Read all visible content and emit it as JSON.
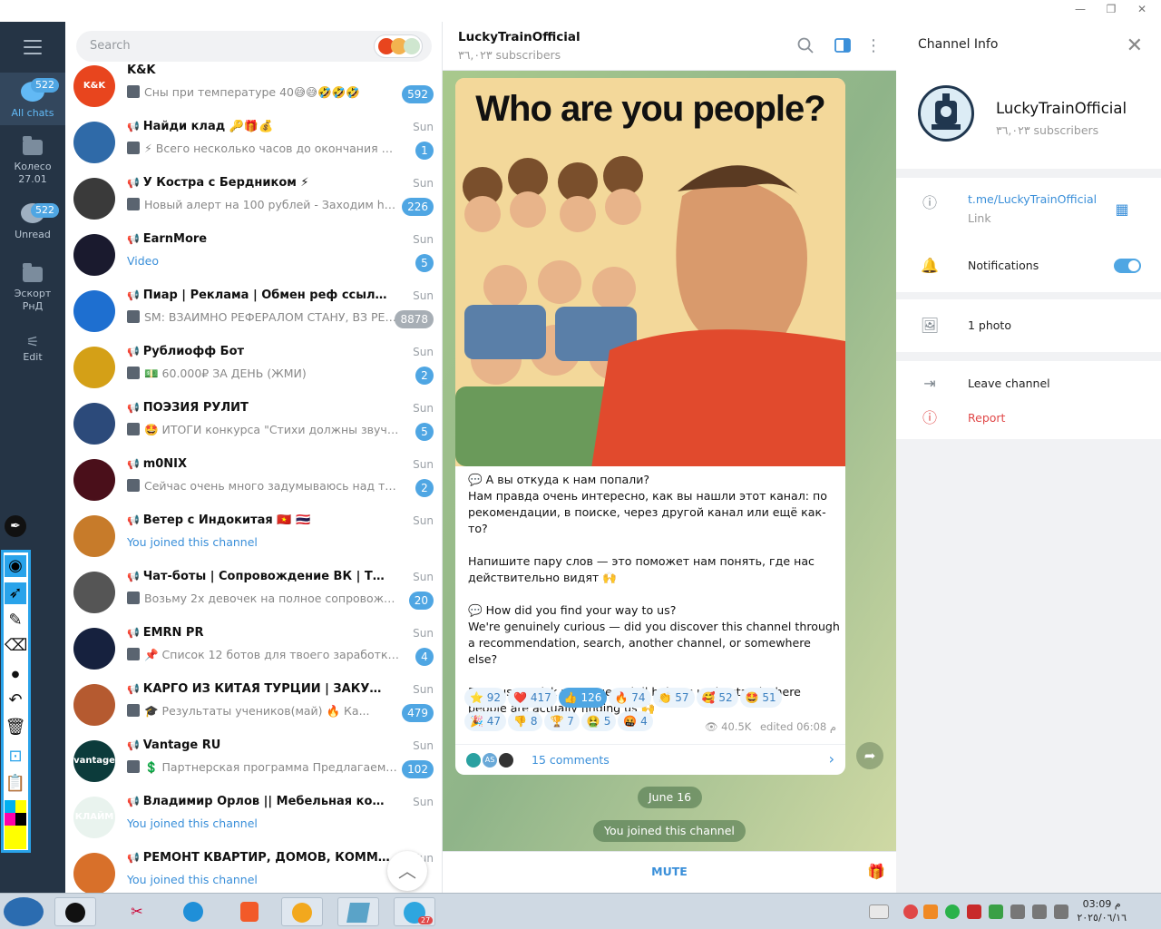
{
  "window": {
    "minimize": "—",
    "restore": "❐",
    "close": "✕"
  },
  "rail": {
    "items": [
      {
        "label": "All chats",
        "badge": "522"
      },
      {
        "label": "Колесо\n27.01"
      },
      {
        "label": "Unread",
        "badge": "522"
      },
      {
        "label": "Эскорт\nРнД"
      },
      {
        "label": "Edit"
      }
    ]
  },
  "search": {
    "placeholder": "Search"
  },
  "chats": [
    {
      "name": "K&K",
      "time": "",
      "preview": "Сны при температуре 40😅😅🤣🤣🤣",
      "badge": "592",
      "avatar": "#e8451e",
      "avtext": "K&K"
    },
    {
      "name": "Найди клад 🔑🎁💰",
      "time": "Sun",
      "preview": "⚡ Всего несколько часов до окончания нашей ...",
      "badge": "1",
      "avatar": "#2f6aa8",
      "avtext": ""
    },
    {
      "name": "У Костра с Бердником ⚡",
      "time": "Sun",
      "preview": "Новый алерт на 100 рублей - Заходим https...",
      "badge": "226",
      "avatar": "#3a3a3a",
      "avtext": ""
    },
    {
      "name": "EarnMore",
      "time": "Sun",
      "preview": "Video",
      "badge": "5",
      "avatar": "#1a1a2e",
      "avtext": ""
    },
    {
      "name": "Пиар | Реклама | Обмен реф ссылками 👈",
      "time": "Sun",
      "preview": "SM: ВЗАИМНО РЕФЕРАЛОМ СТАНУ, ВЗ РЕФ М...",
      "badge": "8878",
      "avatar": "#1e6fd0",
      "avtext": ""
    },
    {
      "name": "Рублиофф Бот",
      "time": "Sun",
      "preview": "💵 60.000₽ ЗА ДЕНЬ (ЖМИ)",
      "badge": "2",
      "avatar": "#d4a017",
      "avtext": ""
    },
    {
      "name": "ПОЭЗИЯ РУЛИТ",
      "time": "Sun",
      "preview": "🤩 ИТОГИ конкурса \"Стихи должны звучать\" ...",
      "badge": "5",
      "avatar": "#2c4a7a",
      "avtext": ""
    },
    {
      "name": "m0NIX",
      "time": "Sun",
      "preview": "Сейчас очень много задумываюсь над тем ч...",
      "badge": "2",
      "avatar": "#4a0f1a",
      "avtext": ""
    },
    {
      "name": "Ветер с Индокитая 🇻🇳 🇹🇭",
      "time": "Sun",
      "preview": "You joined this channel",
      "badge": "",
      "avatar": "#c77b2a",
      "avtext": ""
    },
    {
      "name": "Чат-боты | Сопровождение ВК | Таргет",
      "time": "Sun",
      "preview": "Возьму 2х девочек на полное сопровождение и...",
      "badge": "20",
      "avatar": "#555",
      "avtext": ""
    },
    {
      "name": "EMRN PR",
      "time": "Sun",
      "preview": "📌 Список 12 ботов для твоего заработка в т...",
      "badge": "4",
      "avatar": "#16213e",
      "avtext": ""
    },
    {
      "name": "КАРГО ИЗ КИТАЯ ТУРЦИИ | ЗАКУПКИ ИЗ 7 С...",
      "time": "Sun",
      "preview": "🎓 Результаты учеников(май) 🔥  Ка...",
      "badge": "479",
      "avatar": "#b55a30",
      "avtext": ""
    },
    {
      "name": "Vantage RU",
      "time": "Sun",
      "preview": "💲 Партнерская программа  Предлагаем в...",
      "badge": "102",
      "avatar": "#0c3b3b",
      "avtext": "vantage"
    },
    {
      "name": "Владимир Орлов || Мебельная компания ...",
      "time": "Sun",
      "preview": "You joined this channel",
      "badge": "",
      "avatar": "#e9f3ee",
      "avtext": "КЛАЙМ"
    },
    {
      "name": "РЕМОНТ КВАРТИР, ДОМОВ, КОММЕРЧЕСКИ...",
      "time": "Sun",
      "preview": "You joined this channel",
      "badge": "",
      "avatar": "#d8702a",
      "avtext": ""
    }
  ],
  "chat": {
    "title": "LuckyTrainOfficial",
    "subtitle": "٣٦,٠٢٣ subscribers",
    "image_heading": "Who are you people?",
    "text": [
      "💬 А вы откуда к нам попали?\nНам правда очень интересно, как вы нашли этот канал: по рекомендации, в поиске, через другой канал или ещё как-то?",
      "Напишите пару слов — это поможет нам понять, где нас действительно видят 🙌",
      "💬 How did you find your way to us?\nWe're genuinely curious — did you discover this channel through a recommendation, search, another channel, or somewhere else?",
      "Drop us a quick message — it'll help us understand where people are actually finding us 🙌"
    ],
    "reactions_row1": [
      {
        "emoji": "⭐",
        "count": "92",
        "selected": false
      },
      {
        "emoji": "❤️",
        "count": "417",
        "selected": false
      },
      {
        "emoji": "👍",
        "count": "126",
        "selected": true
      },
      {
        "emoji": "🔥",
        "count": "74",
        "selected": false
      },
      {
        "emoji": "👏",
        "count": "57",
        "selected": false
      },
      {
        "emoji": "🥰",
        "count": "52",
        "selected": false
      },
      {
        "emoji": "🤩",
        "count": "51",
        "selected": false
      }
    ],
    "reactions_row2": [
      {
        "emoji": "🎉",
        "count": "47",
        "selected": false
      },
      {
        "emoji": "👎",
        "count": "8",
        "selected": false
      },
      {
        "emoji": "🏆",
        "count": "7",
        "selected": false
      },
      {
        "emoji": "🤮",
        "count": "5",
        "selected": false
      },
      {
        "emoji": "🤬",
        "count": "4",
        "selected": false
      }
    ],
    "views": "40.5K",
    "edited": "edited 06:08 م",
    "comments_label": "15 comments",
    "comment_avatar_text": "AS",
    "date_pill": "June 16",
    "joined_pill": "You joined this channel",
    "mute_label": "MUTE"
  },
  "info": {
    "title": "Channel Info",
    "name": "LuckyTrainOfficial",
    "subscribers": "٣٦,٠٢٣ subscribers",
    "link": "t.me/LuckyTrainOfficial",
    "link_caption": "Link",
    "notifications": "Notifications",
    "notifications_on": true,
    "photos": "1 photo",
    "leave": "Leave channel",
    "report": "Report"
  },
  "taskbar": {
    "clock_time": "03:09 م",
    "clock_date": "٢٠٢٥/٠٦/١٦",
    "telegram_badge": "27"
  },
  "colors": {
    "accent": "#4fa6e3",
    "link": "#3a8fd9",
    "rail": "#253445",
    "danger": "#e04848",
    "chat_bg": "#95b88a"
  }
}
